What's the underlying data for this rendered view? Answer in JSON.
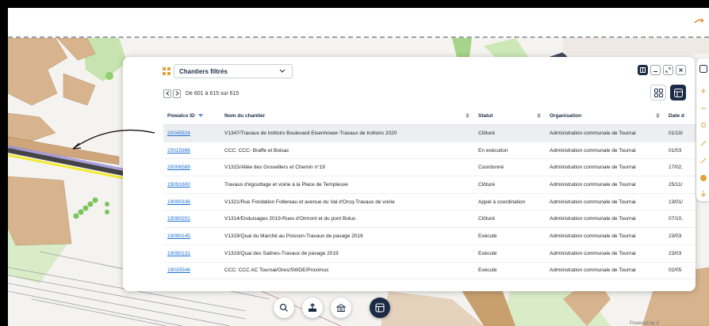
{
  "topbar": {
    "right_icon": "navigation-arrow-icon"
  },
  "rail": {
    "filter_icon": "filter-icon",
    "layers_icon": "layers-icon"
  },
  "panel": {
    "selector_label": "Chantiers filtrés",
    "pager_text": "De 601 à 615 sur 615",
    "columns": [
      "Powalco ID",
      "Nom du chantier",
      "Statut",
      "Organisation",
      "Date d"
    ],
    "rows": [
      {
        "id": "20045924",
        "nom": "V1347/Travaux de trottoirs Boulevard Eisenhower-Travaux de trottoirs 2020",
        "statut": "Clôturé",
        "org": "Administration communale de Tournai",
        "date": "01/10/"
      },
      {
        "id": "20015996",
        "nom": "CCC: CCC- Braffe et Boisac",
        "statut": "En exécution",
        "org": "Administration communale de Tournai",
        "date": "01/03"
      },
      {
        "id": "20006589",
        "nom": "V1315/Allée des Groseillers et Chemin n°19",
        "statut": "Coordonné",
        "org": "Administration communale de Tournai",
        "date": "17/02,"
      },
      {
        "id": "19091600",
        "nom": "Travaux d'égouttage et voirie à la Place de Templeuve",
        "statut": "Clôturé",
        "org": "Administration communale de Tournai",
        "date": "25/11/"
      },
      {
        "id": "19090336",
        "nom": "V1321/Rue Fondation Follereau et avenue du Val d'Orcq-Travaux de voirie",
        "statut": "Appel à coordination",
        "org": "Administration communale de Tournai",
        "date": "13/01/"
      },
      {
        "id": "19090201",
        "nom": "V1314/Enduisages 2019-Rues d'Ormont et du pont Bolus",
        "statut": "Clôturé",
        "org": "Administration communale de Tournai",
        "date": "07/10,"
      },
      {
        "id": "19090145",
        "nom": "V1319/Quai du Marché au Poisson-Travaux de pavage 2019",
        "statut": "Exécuté",
        "org": "Administration communale de Tournai",
        "date": "23/03"
      },
      {
        "id": "19090131",
        "nom": "V1319/Quai des Salines-Travaux de pavage 2019",
        "statut": "Exécuté",
        "org": "Administration communale de Tournai",
        "date": "23/03"
      },
      {
        "id": "19035546",
        "nom": "CCC: CCC AC Tournai/Ores/SWDE/Proximus",
        "statut": "Exécuté",
        "org": "Administration communale de Tournai",
        "date": "02/05"
      }
    ]
  },
  "toolbar": {
    "buttons": [
      "search-icon",
      "upload-icon",
      "building-icon",
      "table-icon"
    ]
  },
  "footer": {
    "powered": "Powered by d"
  },
  "colors": {
    "navy": "#1c2b45",
    "link": "#1a6fd8",
    "map_building": "#d7b48e",
    "map_yellow": "#f2ea30",
    "map_purple": "#9c8fd8"
  }
}
